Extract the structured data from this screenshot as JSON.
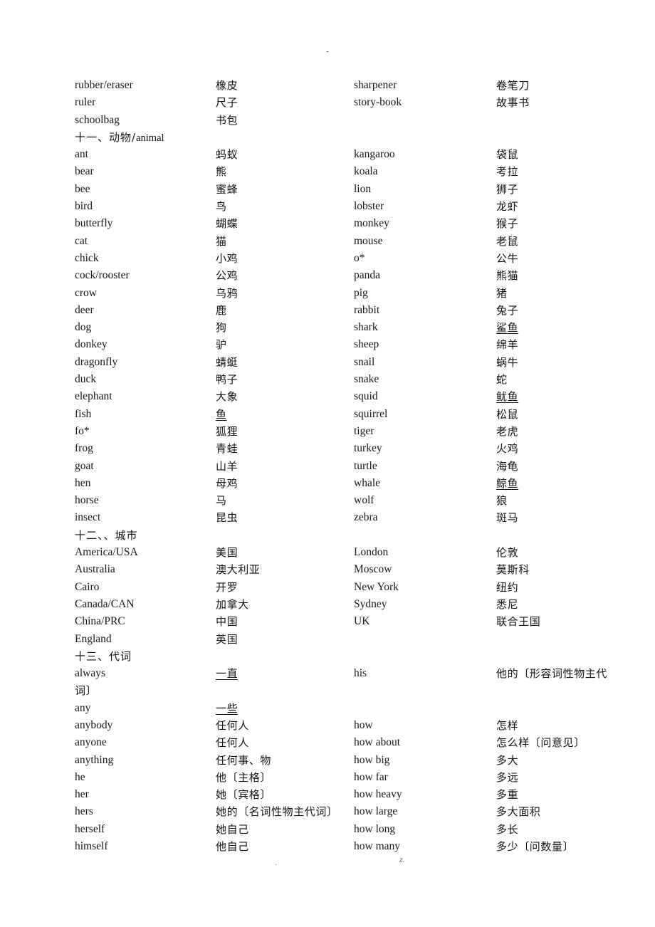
{
  "page": {
    "header_mark": "-",
    "footer_left_mark": ".",
    "footer_right_mark": "z."
  },
  "headings": {
    "animals": {
      "index": "十一、",
      "label": "动物/",
      "latin": "animal"
    },
    "cities": {
      "index": "十二、、",
      "label": "城市",
      "latin": ""
    },
    "pronouns": {
      "index": "十三、",
      "label": "代词",
      "latin": ""
    }
  },
  "continuation": {
    "his_tail": "词〕"
  },
  "rows": [
    {
      "type": "entry",
      "c1": "rubber/eraser",
      "c2": "橡皮",
      "c2u": false,
      "c3": "sharpener",
      "c4": "卷笔刀",
      "c4u": false
    },
    {
      "type": "entry",
      "c1": "ruler",
      "c2": "尺子",
      "c2u": false,
      "c3": "story-book",
      "c4": "故事书",
      "c4u": false
    },
    {
      "type": "entry",
      "c1": "schoolbag",
      "c2": "书包",
      "c2u": false,
      "c3": "",
      "c4": "",
      "c4u": false
    },
    {
      "type": "heading",
      "key": "animals"
    },
    {
      "type": "entry",
      "c1": "ant",
      "c2": "蚂蚁",
      "c2u": false,
      "c3": "kangaroo",
      "c4": "袋鼠",
      "c4u": false
    },
    {
      "type": "entry",
      "c1": "bear",
      "c2": "熊",
      "c2u": false,
      "c3": "koala",
      "c4": "考拉",
      "c4u": false
    },
    {
      "type": "entry",
      "c1": "bee",
      "c2": "蜜蜂",
      "c2u": false,
      "c3": "lion",
      "c4": "狮子",
      "c4u": false
    },
    {
      "type": "entry",
      "c1": "bird",
      "c2": "鸟",
      "c2u": false,
      "c3": "lobster",
      "c4": "龙虾",
      "c4u": false
    },
    {
      "type": "entry",
      "c1": "butterfly",
      "c2": "蝴蝶",
      "c2u": false,
      "c3": "monkey",
      "c4": "猴子",
      "c4u": false
    },
    {
      "type": "entry",
      "c1": "cat",
      "c2": "猫",
      "c2u": false,
      "c3": "mouse",
      "c4": "老鼠",
      "c4u": false
    },
    {
      "type": "entry",
      "c1": "chick",
      "c2": "小鸡",
      "c2u": false,
      "c3": "o*",
      "c4": "公牛",
      "c4u": false
    },
    {
      "type": "entry",
      "c1": "cock/rooster",
      "c2": "公鸡",
      "c2u": false,
      "c3": "panda",
      "c4": "熊猫",
      "c4u": false
    },
    {
      "type": "entry",
      "c1": "crow",
      "c2": "乌鸦",
      "c2u": false,
      "c3": "pig",
      "c4": "猪",
      "c4u": false
    },
    {
      "type": "entry",
      "c1": "deer",
      "c2": "鹿",
      "c2u": false,
      "c3": "rabbit",
      "c4": "兔子",
      "c4u": false
    },
    {
      "type": "entry",
      "c1": "dog",
      "c2": "狗",
      "c2u": false,
      "c3": "shark",
      "c4": "鲨鱼",
      "c4u": true
    },
    {
      "type": "entry",
      "c1": "donkey",
      "c2": "驴",
      "c2u": false,
      "c3": "sheep",
      "c4": "绵羊",
      "c4u": false
    },
    {
      "type": "entry",
      "c1": "dragonfly",
      "c2": "蜻蜓",
      "c2u": false,
      "c3": "snail",
      "c4": "蜗牛",
      "c4u": false
    },
    {
      "type": "entry",
      "c1": "duck",
      "c2": "鸭子",
      "c2u": false,
      "c3": "snake",
      "c4": "蛇",
      "c4u": false
    },
    {
      "type": "entry",
      "c1": "elephant",
      "c2": "大象",
      "c2u": false,
      "c3": "squid",
      "c4": "鱿鱼",
      "c4u": true
    },
    {
      "type": "entry",
      "c1": "fish",
      "c2": "鱼",
      "c2u": true,
      "c3": "squirrel",
      "c4": "松鼠",
      "c4u": false
    },
    {
      "type": "entry",
      "c1": "fo*",
      "c2": "狐狸",
      "c2u": false,
      "c3": "tiger",
      "c4": "老虎",
      "c4u": false
    },
    {
      "type": "entry",
      "c1": "frog",
      "c2": "青蛙",
      "c2u": false,
      "c3": "turkey",
      "c4": "火鸡",
      "c4u": false
    },
    {
      "type": "entry",
      "c1": "goat",
      "c2": "山羊",
      "c2u": false,
      "c3": "turtle",
      "c4": "海龟",
      "c4u": false
    },
    {
      "type": "entry",
      "c1": "hen",
      "c2": "母鸡",
      "c2u": false,
      "c3": "whale",
      "c4": "鲸鱼",
      "c4u": true
    },
    {
      "type": "entry",
      "c1": "horse",
      "c2": "马",
      "c2u": false,
      "c3": "wolf",
      "c4": "狼",
      "c4u": false
    },
    {
      "type": "entry",
      "c1": "insect",
      "c2": "昆虫",
      "c2u": false,
      "c3": "zebra",
      "c4": "斑马",
      "c4u": false
    },
    {
      "type": "heading",
      "key": "cities"
    },
    {
      "type": "entry",
      "c1": "America/USA",
      "c2": "美国",
      "c2u": false,
      "c3": "London",
      "c4": "伦敦",
      "c4u": false
    },
    {
      "type": "entry",
      "c1": "Australia",
      "c2": "澳大利亚",
      "c2u": false,
      "c3": "Moscow",
      "c4": "莫斯科",
      "c4u": false
    },
    {
      "type": "entry",
      "c1": "Cairo",
      "c2": "开罗",
      "c2u": false,
      "c3": "New York",
      "c4": "纽约",
      "c4u": false
    },
    {
      "type": "entry",
      "c1": "Canada/CAN",
      "c2": "加拿大",
      "c2u": false,
      "c3": "Sydney",
      "c4": "悉尼",
      "c4u": false
    },
    {
      "type": "entry",
      "c1": "China/PRC",
      "c2": "中国",
      "c2u": false,
      "c3": "UK",
      "c4": "联合王国",
      "c4u": false
    },
    {
      "type": "entry",
      "c1": "England",
      "c2": "英国",
      "c2u": false,
      "c3": "",
      "c4": "",
      "c4u": false
    },
    {
      "type": "heading",
      "key": "pronouns"
    },
    {
      "type": "entry",
      "c1": "always",
      "c2": "一直",
      "c2u": true,
      "c3": "his",
      "c4": "他的〔形容词性物主代",
      "c4u": false
    },
    {
      "type": "continuation",
      "key": "his_tail",
      "c1": "any",
      "c2": "一些",
      "c2u": true
    },
    {
      "type": "entry",
      "c1": "anybody",
      "c2": "任何人",
      "c2u": false,
      "c3": "how",
      "c4": "怎样",
      "c4u": false
    },
    {
      "type": "entry",
      "c1": "anyone",
      "c2": "任何人",
      "c2u": false,
      "c3": "how about",
      "c4": "怎么样〔问意见〕",
      "c4u": false
    },
    {
      "type": "entry",
      "c1": "anything",
      "c2": "任何事、物",
      "c2u": false,
      "c3": "how big",
      "c4": "多大",
      "c4u": false
    },
    {
      "type": "entry",
      "c1": "he",
      "c2": "他〔主格〕",
      "c2u": false,
      "c3": "how far",
      "c4": "多远",
      "c4u": false
    },
    {
      "type": "entry",
      "c1": "her",
      "c2": "她〔宾格〕",
      "c2u": false,
      "c3": "how heavy",
      "c4": "多重",
      "c4u": false
    },
    {
      "type": "entry",
      "c1": "hers",
      "c2": "她的〔名词性物主代词〕",
      "c2u": false,
      "c3": "how large",
      "c4": "多大面积",
      "c4u": false
    },
    {
      "type": "entry",
      "c1": "herself",
      "c2": "她自己",
      "c2u": false,
      "c3": "how long",
      "c4": "多长",
      "c4u": false
    },
    {
      "type": "entry",
      "c1": "himself",
      "c2": "他自己",
      "c2u": false,
      "c3": "how many",
      "c4": "多少〔问数量〕",
      "c4u": false
    }
  ]
}
